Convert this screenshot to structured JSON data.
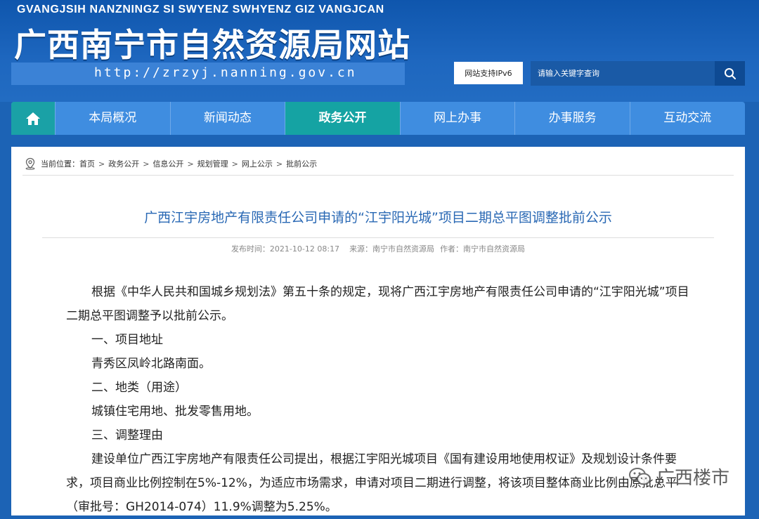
{
  "header": {
    "pinyin": "GVANGJSIH NANZNINGZ SI SWYENZ SWHYENZ GIZ VANGJCAN",
    "title": "广西南宁市自然资源局网站",
    "url": "http://zrzyj.nanning.gov.cn",
    "ipv6_label": "网站支持IPv6",
    "search_placeholder": "请输入关键字查询"
  },
  "nav": {
    "items": [
      "本局概况",
      "新闻动态",
      "政务公开",
      "网上办事",
      "办事服务",
      "互动交流"
    ],
    "active_index": 2
  },
  "breadcrumb": {
    "label": "当前位置：",
    "items": [
      "首页",
      "政务公开",
      "信息公开",
      "规划管理",
      "网上公示",
      "批前公示"
    ],
    "separator": ">"
  },
  "article": {
    "title": "广西江宇房地产有限责任公司申请的“江宇阳光城”项目二期总平图调整批前公示",
    "publish_time": "发布时间：2021-10-12 08:17",
    "source": "来源：南宁市自然资源局",
    "author": "作者：南宁市自然资源局",
    "paragraphs": [
      "根据《中华人民共和国城乡规划法》第五十条的规定，现将广西江宇房地产有限责任公司申请的“江宇阳光城”项目二期总平图调整予以批前公示。",
      "一、项目地址",
      "青秀区凤岭北路南面。",
      "二、地类（用途）",
      "城镇住宅用地、批发零售用地。",
      "三、调整理由",
      "建设单位广西江宇房地产有限责任公司提出，根据江宇阳光城项目《国有建设用地使用权证》及规划设计条件要求，项目商业比例控制在5%-12%，为适应市场需求，申请对项目二期进行调整，将该项目整体商业比例由原批总平（审批号：GH2014-074）11.9%调整为5.25%。"
    ]
  },
  "watermark": {
    "text": "广西楼市"
  }
}
